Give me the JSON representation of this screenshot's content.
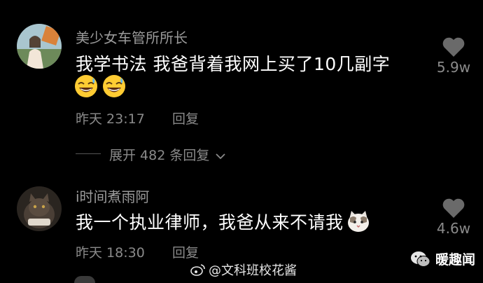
{
  "comments": [
    {
      "username": "美少女车管所所长",
      "text": "我学书法 我爸背着我网上买了10几副字",
      "emojis": [
        "grinning-sweat-emoji",
        "grinning-sweat-emoji"
      ],
      "time": "昨天 23:17",
      "reply_label": "回复",
      "likes": "5.9w",
      "expand_label": "展开 482 条回复"
    },
    {
      "username": "i时间煮雨阿",
      "text": "我一个执业律师，我爸从来不请我",
      "emojis": [
        "cat-emoji"
      ],
      "time": "昨天 18:30",
      "reply_label": "回复",
      "likes": "4.6w"
    }
  ],
  "watermark": {
    "weibo_handle": "@文科班校花酱",
    "wechat_account": "暖趣闻"
  },
  "colors": {
    "background": "#000000",
    "text_primary": "#ffffff",
    "text_secondary": "#8a8a8a"
  }
}
